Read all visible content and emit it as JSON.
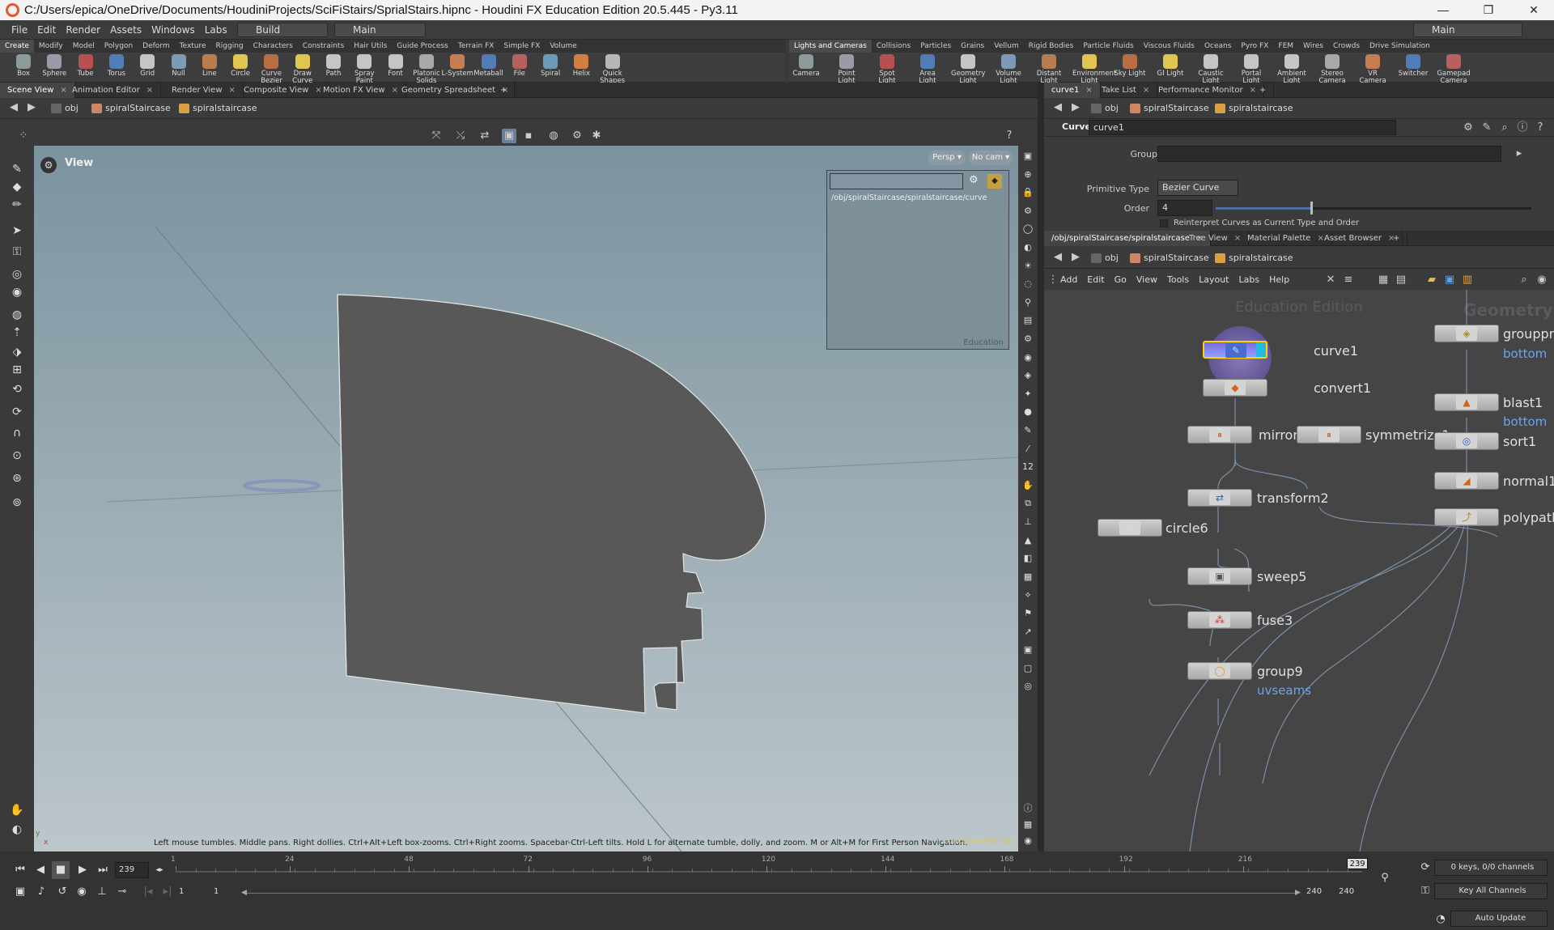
{
  "window": {
    "title": "C:/Users/epica/OneDrive/Documents/HoudiniProjects/SciFiStairs/SprialStairs.hipnc - Houdini FX Education Edition 20.5.445 - Py3.11",
    "min": "—",
    "max": "❐",
    "close": "✕"
  },
  "menu": {
    "items": [
      "File",
      "Edit",
      "Render",
      "Assets",
      "Windows",
      "Labs",
      "Help"
    ],
    "desktop": "Build",
    "main": "Main",
    "right_desktop": "Main"
  },
  "shelf_left": {
    "tabs": [
      "Create",
      "Modify",
      "Model",
      "Polygon",
      "Deform",
      "Texture",
      "Rigging",
      "Characters",
      "Constraints",
      "Hair Utils",
      "Guide Process",
      "Terrain FX",
      "Simple FX",
      "Volume"
    ],
    "tools": [
      "Box",
      "Sphere",
      "Tube",
      "Torus",
      "Grid",
      "Null",
      "Line",
      "Circle",
      "Curve Bezier",
      "Draw Curve",
      "Path",
      "Spray Paint",
      "Font",
      "Platonic Solids",
      "L-System",
      "Metaball",
      "File",
      "Spiral",
      "Helix",
      "Quick Shapes"
    ]
  },
  "shelf_right": {
    "tabs": [
      "Lights and Cameras",
      "Collisions",
      "Particles",
      "Grains",
      "Vellum",
      "Rigid Bodies",
      "Particle Fluids",
      "Viscous Fluids",
      "Oceans",
      "Pyro FX",
      "FEM",
      "Wires",
      "Crowds",
      "Drive Simulation"
    ],
    "tools": [
      "Camera",
      "Point Light",
      "Spot Light",
      "Area Light",
      "Geometry Light",
      "Volume Light",
      "Distant Light",
      "Environment Light",
      "Sky Light",
      "GI Light",
      "Caustic Light",
      "Portal Light",
      "Ambient Light",
      "Stereo Camera",
      "VR Camera",
      "Switcher",
      "Gamepad Camera"
    ]
  },
  "left_pane_tabs": [
    "Scene View",
    "Animation Editor",
    "Render View",
    "Composite View",
    "Motion FX View",
    "Geometry Spreadsheet"
  ],
  "path": {
    "obj": "obj",
    "net": "spiralStaircase",
    "node": "spiralstaircase"
  },
  "viewport": {
    "title": "View",
    "persp": "Persp ▾",
    "cam": "No cam ▾",
    "inset_path": "/obj/spiralStaircase/spiralstaircase/curve",
    "inset_wm": "Education",
    "hint": "Left mouse tumbles. Middle pans. Right dollies. Ctrl+Alt+Left box-zooms. Ctrl+Right zooms. Spacebar-Ctrl-Left tilts. Hold L for alternate tumble, dolly, and zoom. M or Alt+M for First Person Navigation.",
    "edu": "Education Edition",
    "axis_y": "y",
    "axis_x": "x"
  },
  "right_top_tabs": [
    "curve1",
    "Take List",
    "Performance Monitor"
  ],
  "param": {
    "type": "Curve",
    "name": "curve1",
    "group_label": "Group",
    "group_value": "",
    "prim_label": "Primitive Type",
    "prim_value": "Bezier Curve",
    "order_label": "Order",
    "order_value": "4",
    "reinterpret": "Reinterpret Curves as Current Type and Order",
    "order_fraction": 0.3
  },
  "right_bottom_tabs": [
    "/obj/spiralStaircase/spiralstaircase",
    "Tree View",
    "Material Palette",
    "Asset Browser"
  ],
  "net_menu": [
    "Add",
    "Edit",
    "Go",
    "View",
    "Tools",
    "Layout",
    "Labs",
    "Help"
  ],
  "network": {
    "wm_edu": "Education Edition",
    "wm_geo": "Geometry",
    "nodes": {
      "curve1": "curve1",
      "convert1": "convert1",
      "mirror": "mirror",
      "symmetrize1": "symmetrize1",
      "transform2": "transform2",
      "circle6": "circle6",
      "sweep5": "sweep5",
      "fuse3": "fuse3",
      "group9": "group9",
      "grouppr": "grouppro",
      "blast1": "blast1",
      "sort1": "sort1",
      "normal1": "normal1",
      "polypath": "polypath"
    },
    "subs": {
      "group9": "uvseams",
      "grouppr": "bottom",
      "blast1": "bottom"
    }
  },
  "timeline": {
    "frame": "239",
    "ticks": [
      "1",
      "24",
      "48",
      "72",
      "96",
      "120",
      "144",
      "168",
      "192",
      "216"
    ],
    "marker": "239",
    "start": "1",
    "start2": "1",
    "end": "240",
    "end2": "240",
    "keys": "0 keys, 0/0 channels",
    "keyall": "Key All Channels",
    "autoupdate": "Auto Update",
    "current_fraction": 0.996
  }
}
